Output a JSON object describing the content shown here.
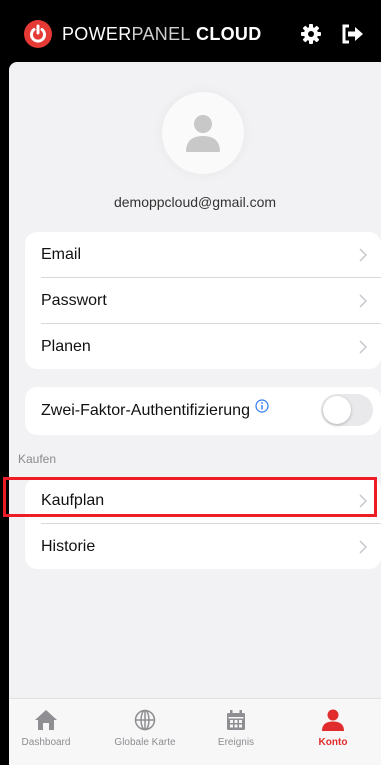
{
  "header": {
    "title_part1": "POWER",
    "title_part2": "PANEL",
    "title_part3": " CLOUD",
    "logo_icon": "power-logo-icon",
    "settings_icon": "gear-icon",
    "logout_icon": "logout-icon"
  },
  "profile": {
    "avatar_icon": "user-avatar-icon",
    "email": "demoppcloud@gmail.com"
  },
  "account_items": [
    {
      "label": "Email"
    },
    {
      "label": "Passwort"
    },
    {
      "label": "Planen"
    }
  ],
  "two_factor": {
    "label": "Zwei-Faktor-Authentifizierung",
    "enabled": false
  },
  "purchase_section": {
    "title": "Kaufen",
    "items": [
      {
        "label": "Kaufplan"
      },
      {
        "label": "Historie"
      }
    ]
  },
  "tabs": [
    {
      "label": "Dashboard",
      "icon": "house-icon",
      "active": false
    },
    {
      "label": "Globale Karte",
      "icon": "globe-icon",
      "active": false
    },
    {
      "label": "Ereignis",
      "icon": "calendar-icon",
      "active": false
    },
    {
      "label": "Konto",
      "icon": "user-icon",
      "active": true
    }
  ],
  "colors": {
    "accent": "#e02c2c",
    "highlight": "#ee1c24",
    "header_bg": "#000000",
    "content_bg": "#f2f2f4"
  }
}
